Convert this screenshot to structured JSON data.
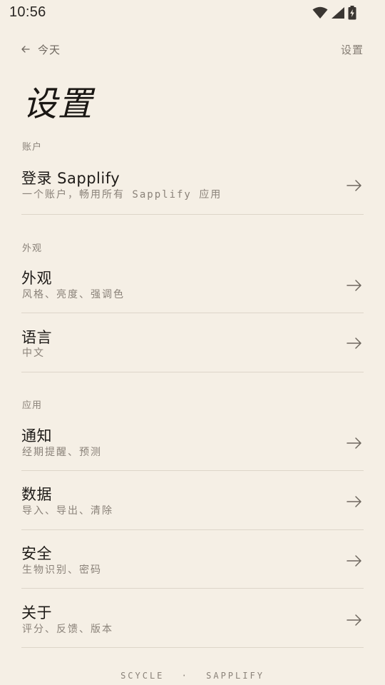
{
  "status_bar": {
    "time": "10:56"
  },
  "topbar": {
    "back_label": "今天",
    "current_label": "设置"
  },
  "page": {
    "title": "设置"
  },
  "sections": [
    {
      "label": "账户"
    },
    {
      "label": "外观"
    },
    {
      "label": "应用"
    }
  ],
  "rows": [
    {
      "title": "登录 Sapplify",
      "subtitle": "一个账户，畅用所有 Sapplify 应用"
    },
    {
      "title": "外观",
      "subtitle": "风格、亮度、强调色"
    },
    {
      "title": "语言",
      "subtitle": "中文"
    },
    {
      "title": "通知",
      "subtitle": "经期提醒、预测"
    },
    {
      "title": "数据",
      "subtitle": "导入、导出、清除"
    },
    {
      "title": "安全",
      "subtitle": "生物识别、密码"
    },
    {
      "title": "关于",
      "subtitle": "评分、反馈、版本"
    }
  ],
  "footer": {
    "left": "SCYCLE",
    "separator": "·",
    "right": "SAPPLIFY"
  },
  "icons": {
    "back": "arrow-left-icon",
    "row_arrow": "arrow-right-icon",
    "wifi": "wifi-icon",
    "signal": "signal-icon",
    "battery": "battery-charging-icon"
  },
  "colors": {
    "background": "#f5efe5",
    "text_primary": "#1e1b18",
    "text_secondary": "#8a8279",
    "divider": "#ddd5c9"
  }
}
